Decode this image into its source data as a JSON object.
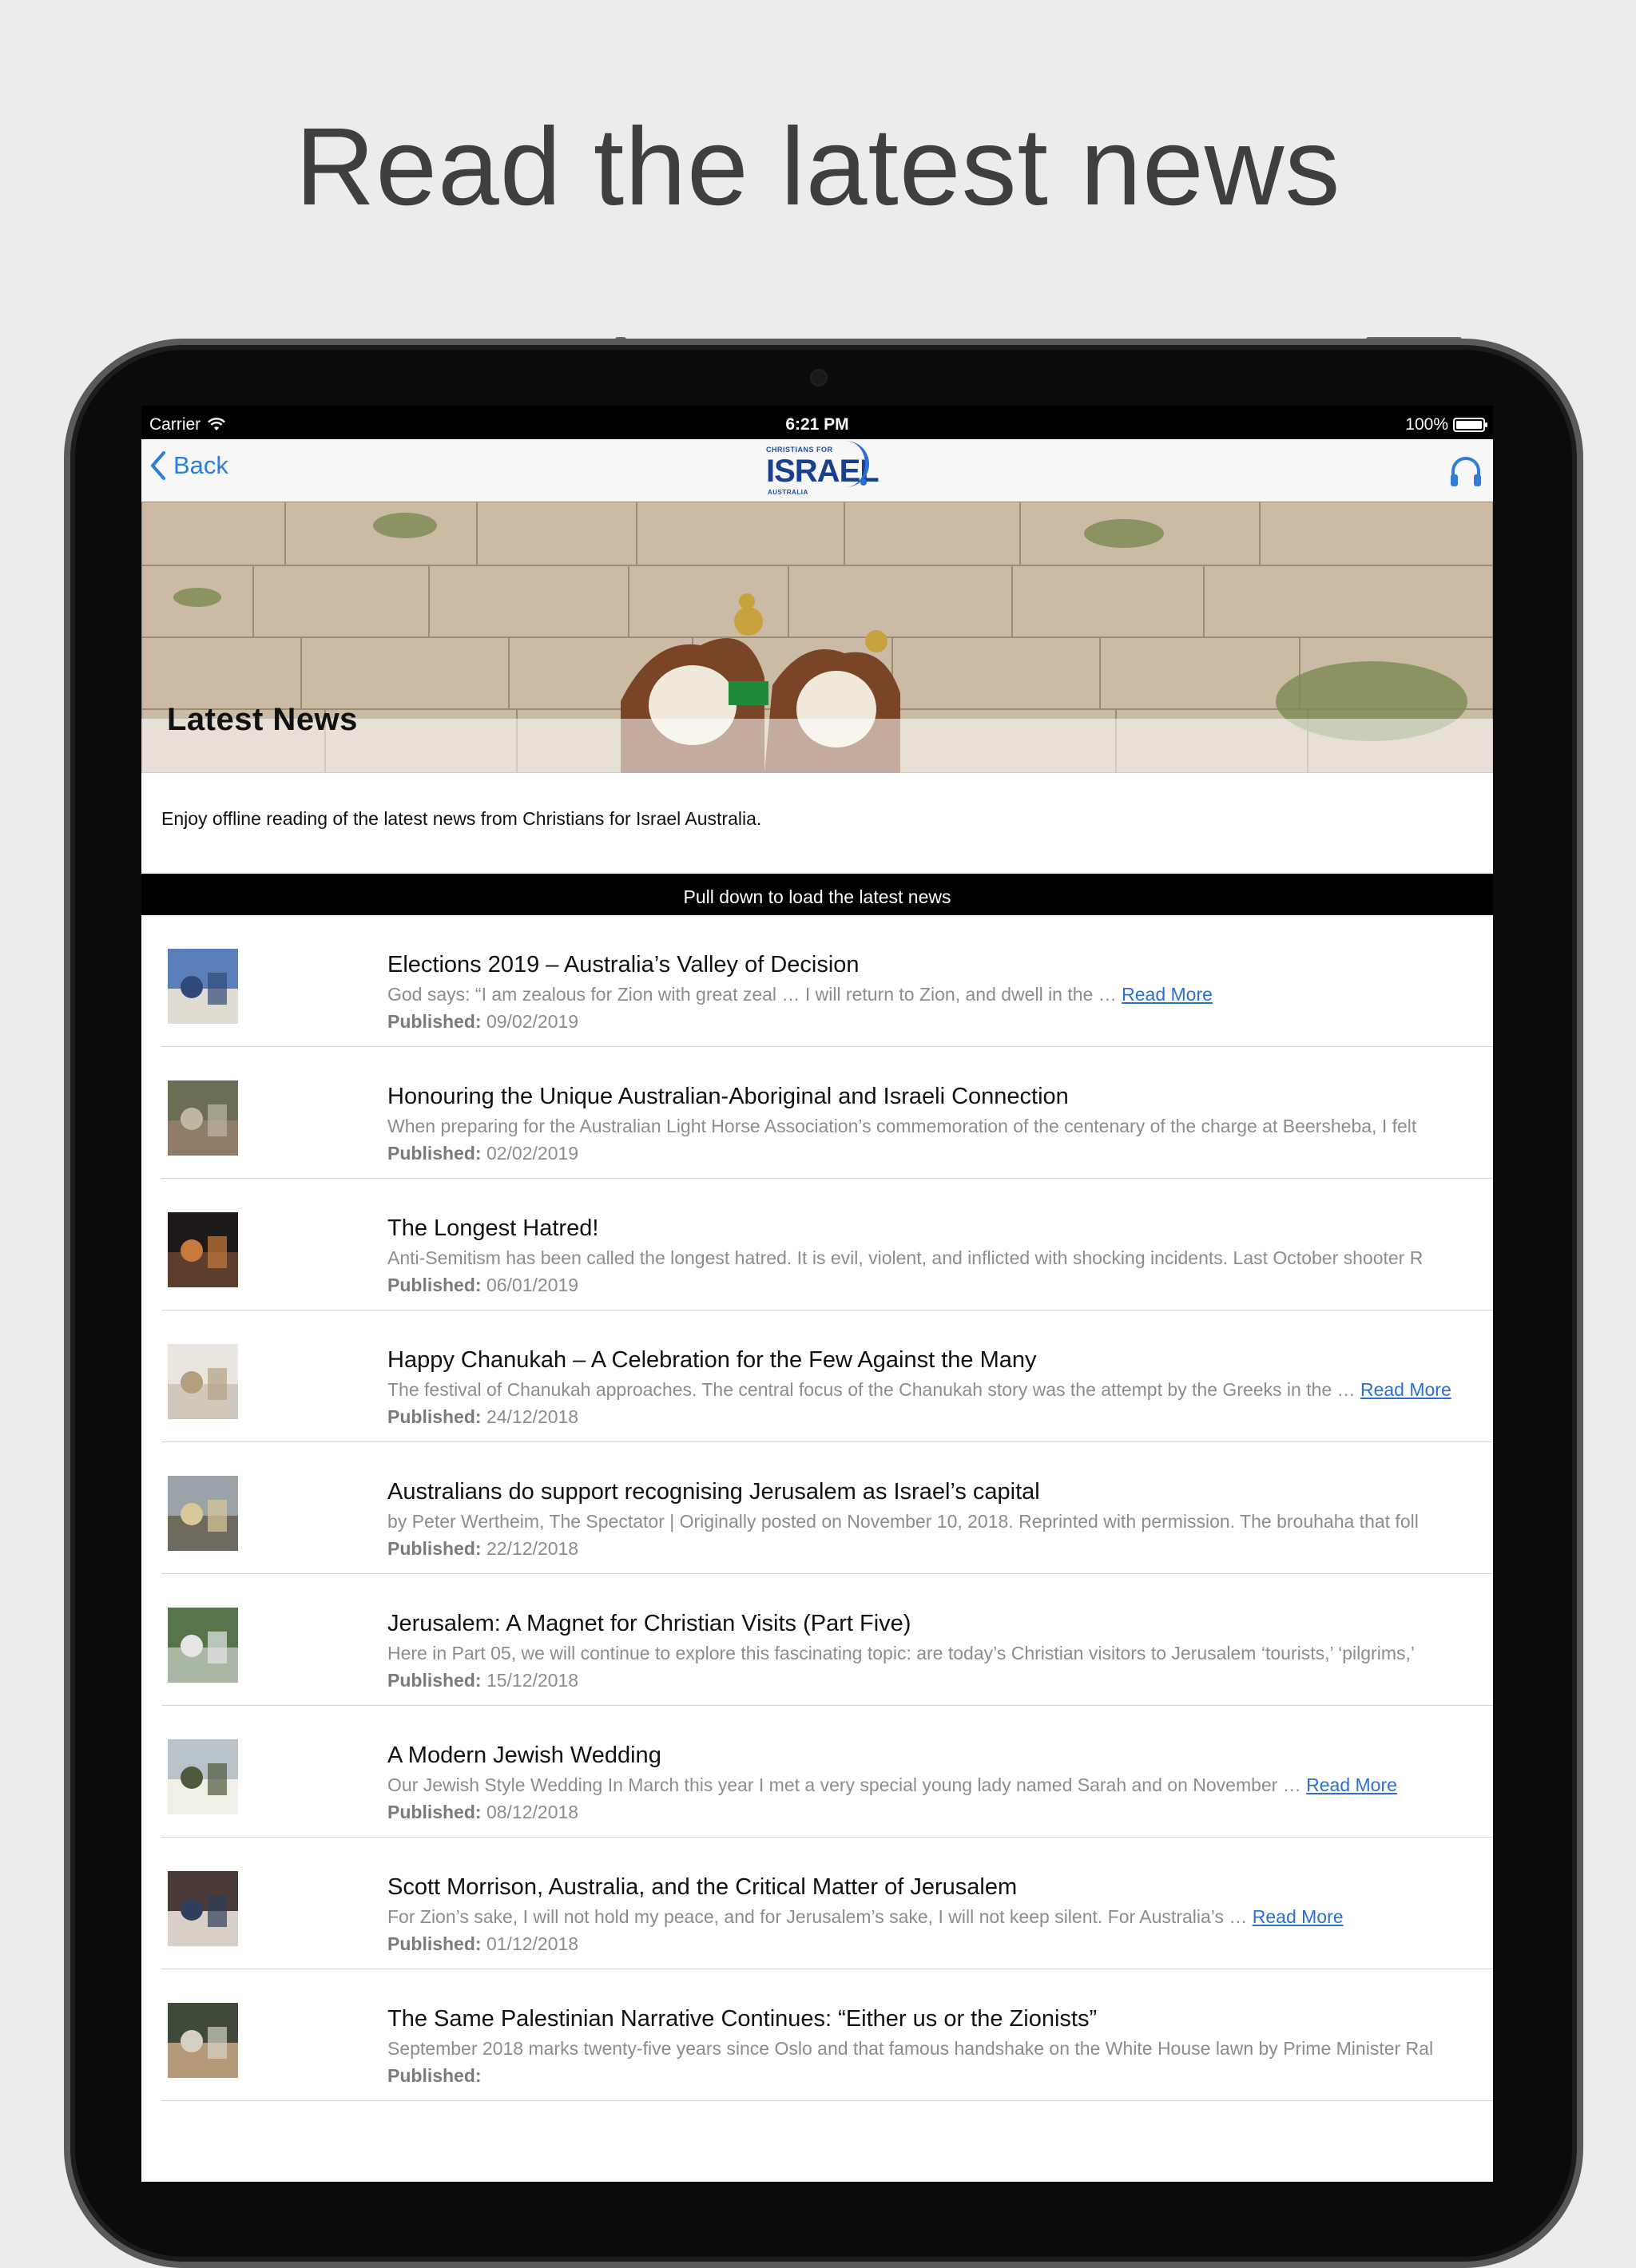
{
  "headline": "Read the latest news",
  "statusbar": {
    "carrier": "Carrier",
    "time": "6:21 PM",
    "battery": "100%"
  },
  "navbar": {
    "back_label": "Back",
    "logo_top": "CHRISTIANS FOR",
    "logo_main": "ISRAEL",
    "logo_bottom": "AUSTRALIA"
  },
  "hero": {
    "title": "Latest News"
  },
  "intro": {
    "text": "Enjoy offline reading of the latest news from Christians for Israel Australia."
  },
  "pull_hint": "Pull down to load the latest news",
  "published_label": "Published:",
  "read_more": "Read More",
  "articles": [
    {
      "title": "Elections 2019 – Australia’s Valley of Decision",
      "excerpt": "God says: “I am zealous for Zion with great zeal … I will return to Zion, and dwell in the … ",
      "read_more": "Read More",
      "date": "09/02/2019"
    },
    {
      "title": "Honouring the Unique Australian-Aboriginal and Israeli Connection",
      "excerpt": "When preparing for the Australian Light Horse Association’s commemoration of the centenary of the charge at Beersheba, I felt",
      "read_more": "",
      "date": "02/02/2019"
    },
    {
      "title": "The Longest Hatred!",
      "excerpt": "Anti-Semitism has been called the longest hatred. It is evil, violent, and inflicted with shocking incidents. Last October shooter R",
      "read_more": "",
      "date": "06/01/2019"
    },
    {
      "title": "Happy Chanukah – A Celebration for the Few Against the Many",
      "excerpt": "The festival of Chanukah approaches.  The central focus of the Chanukah story was the attempt by the Greeks in the … ",
      "read_more": "Read More",
      "date": "24/12/2018"
    },
    {
      "title": "Australians do support recognising Jerusalem as Israel’s capital",
      "excerpt": "by Peter Wertheim, The Spectator  | Originally posted on  November 10, 2018. Reprinted with permission. The brouhaha that foll",
      "read_more": "",
      "date": "22/12/2018"
    },
    {
      "title": "Jerusalem: A Magnet for Christian Visits (Part Five)",
      "excerpt": "Here in Part 05, we will continue to explore this fascinating topic: are today’s Christian visitors to Jerusalem ‘tourists,’ ‘pilgrims,’",
      "read_more": "",
      "date": "15/12/2018"
    },
    {
      "title": "A Modern Jewish Wedding",
      "excerpt": "Our Jewish Style Wedding In March this year I met a very special young lady named Sarah and on November … ",
      "read_more": "Read More",
      "date": "08/12/2018"
    },
    {
      "title": "Scott Morrison, Australia, and the Critical Matter of Jerusalem",
      "excerpt": "For Zion’s sake, I will not hold my peace, and for Jerusalem’s sake, I will not keep silent. For Australia’s … ",
      "read_more": "Read More",
      "date": "01/12/2018"
    },
    {
      "title": "The Same Palestinian Narrative Continues: “Either us or the Zionists”",
      "excerpt": "September 2018 marks twenty-five years since Oslo and that famous handshake on the White House lawn by Prime Minister Ral",
      "read_more": "",
      "date": ""
    }
  ],
  "colors": {
    "accent": "#2f7dd7",
    "background": "#ececec",
    "device": "#0b0b0b"
  }
}
